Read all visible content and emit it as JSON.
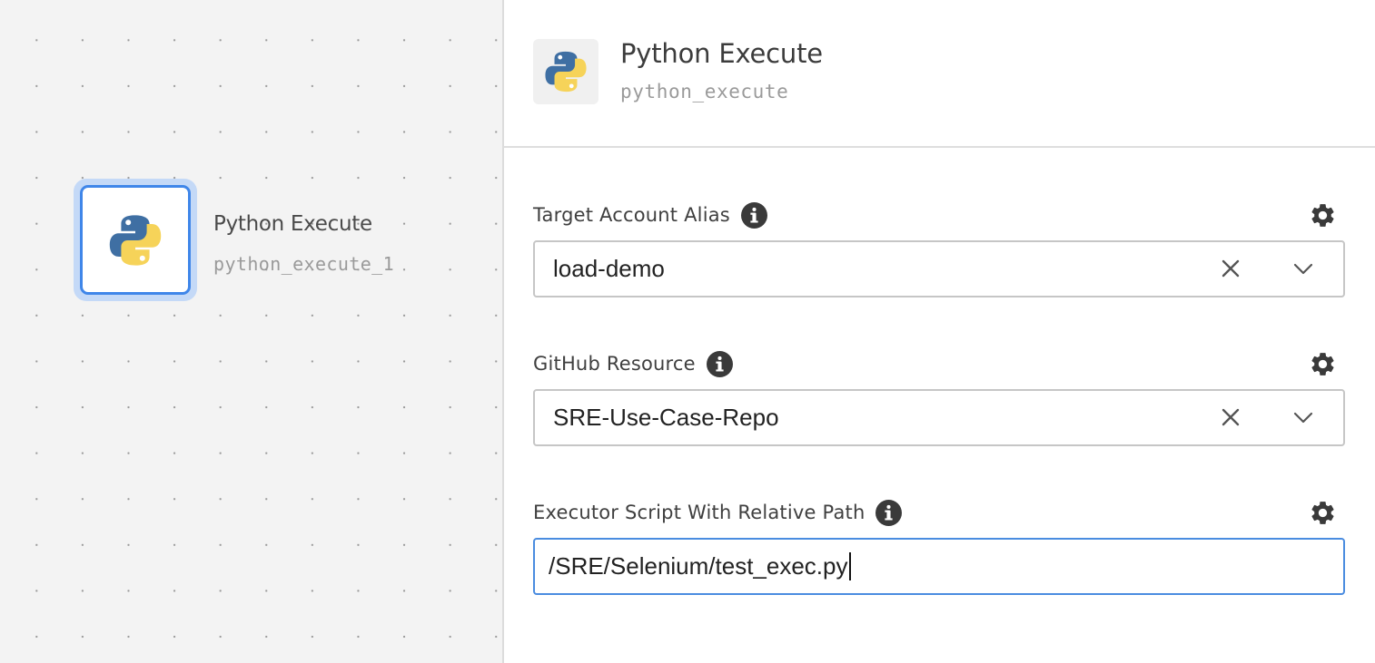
{
  "canvas": {
    "node": {
      "icon": "python-logo-icon",
      "title": "Python Execute",
      "id": "python_execute_1"
    }
  },
  "panel": {
    "header": {
      "icon": "python-logo-icon",
      "title": "Python Execute",
      "subtitle": "python_execute"
    },
    "fields": [
      {
        "label": "Target Account Alias",
        "type": "select",
        "value": "load-demo",
        "icons": [
          "info-icon",
          "gear-icon",
          "clear-icon",
          "chevron-down-icon"
        ]
      },
      {
        "label": "GitHub Resource",
        "type": "select",
        "value": "SRE-Use-Case-Repo",
        "icons": [
          "info-icon",
          "gear-icon",
          "clear-icon",
          "chevron-down-icon"
        ]
      },
      {
        "label": "Executor Script With Relative Path",
        "type": "text",
        "value": "/SRE/Selenium/test_exec.py",
        "focused": true,
        "icons": [
          "info-icon",
          "gear-icon"
        ]
      }
    ]
  },
  "colors": {
    "accent": "#3f86e9",
    "node_halo": "#c4d9f7",
    "canvas_bg": "#f3f3f3",
    "python_blue": "#3f6fa3",
    "python_yellow": "#f6d359"
  }
}
